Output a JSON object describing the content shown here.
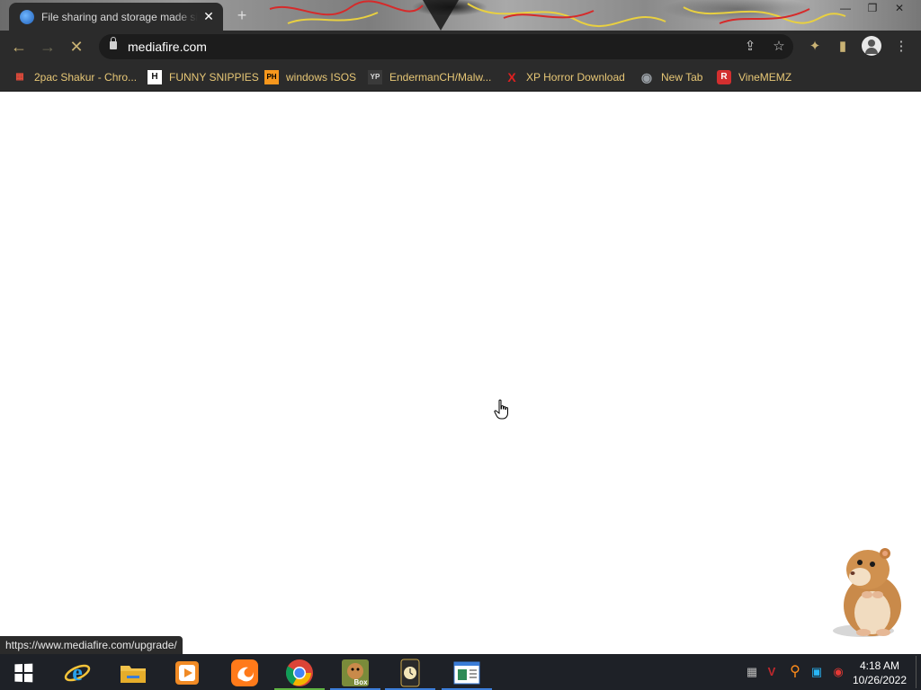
{
  "browser": {
    "tab": {
      "title": "File sharing and storage made simple",
      "close_glyph": "✕"
    },
    "new_tab_glyph": "+",
    "window_controls": {
      "minimize": "—",
      "restore": "❐",
      "close": "✕"
    },
    "nav": {
      "back": "←",
      "forward": "→",
      "stop": "✕"
    },
    "address": {
      "url": "mediafire.com"
    },
    "omnibox_icons": {
      "share": "⇪",
      "star": "☆"
    },
    "toolbar_icons": {
      "extensions": "✦",
      "sidepanel": "▮",
      "menu": "⋮"
    },
    "bookmarks": [
      {
        "label": "2pac Shakur - Chro...",
        "icon": "chrome-store-icon",
        "glyph": "▦",
        "color": "#e24b3b"
      },
      {
        "label": "FUNNY SNIPPIES",
        "icon": "h-icon",
        "glyph": "H",
        "color": "#ffffff"
      },
      {
        "label": "windows ISOS",
        "icon": "ph-icon",
        "glyph": "PH",
        "color": "#f7971d"
      },
      {
        "label": "EndermanCH/Malw...",
        "icon": "yp-icon",
        "glyph": "YP",
        "color": "#3a3a3a"
      },
      {
        "label": "XP Horror Download",
        "icon": "x-icon",
        "glyph": "X",
        "color": "#e02020"
      },
      {
        "label": "New Tab",
        "icon": "globe-icon",
        "glyph": "◉",
        "color": "#9aa0a6"
      },
      {
        "label": "VineMEMZ",
        "icon": "r-icon",
        "glyph": "R",
        "color": "#d32f2f"
      }
    ],
    "status_url": "https://www.mediafire.com/upgrade/"
  },
  "taskbar": {
    "apps": [
      {
        "name": "start",
        "icon": "windows-start-icon"
      },
      {
        "name": "internet-explorer",
        "icon": "ie-icon",
        "glyph": "e",
        "color": "#2aa0ea"
      },
      {
        "name": "file-explorer",
        "icon": "folder-icon",
        "glyph": "▬",
        "color": "#f2c24a"
      },
      {
        "name": "media-player",
        "icon": "media-player-icon",
        "glyph": "▶",
        "color": "#f08a24"
      },
      {
        "name": "uc-browser",
        "icon": "uc-browser-icon",
        "glyph": "◕",
        "color": "#ff7a1a"
      },
      {
        "name": "chrome",
        "icon": "chrome-icon",
        "glyph": "◉",
        "color": "#4285f4"
      },
      {
        "name": "box",
        "icon": "box-app-icon",
        "glyph": "Box",
        "color": "#7a8b3a"
      },
      {
        "name": "watch",
        "icon": "watch-app-icon",
        "glyph": "◷",
        "color": "#c9a64a"
      },
      {
        "name": "document",
        "icon": "document-app-icon",
        "glyph": "▤",
        "color": "#3b7dd8"
      }
    ],
    "tray_icons": [
      {
        "icon": "qr-tray-icon",
        "glyph": "▦",
        "color": "#bbbbbb"
      },
      {
        "icon": "antivirus-tray-icon",
        "glyph": "V",
        "color": "#c0282d"
      },
      {
        "icon": "search-tray-icon",
        "glyph": "⚲",
        "color": "#ff8c1a"
      },
      {
        "icon": "monitor-tray-icon",
        "glyph": "▣",
        "color": "#29b6f6"
      },
      {
        "icon": "record-tray-icon",
        "glyph": "◉",
        "color": "#e53935"
      }
    ],
    "clock": {
      "time": "4:18 AM",
      "date": "10/26/2022"
    }
  }
}
